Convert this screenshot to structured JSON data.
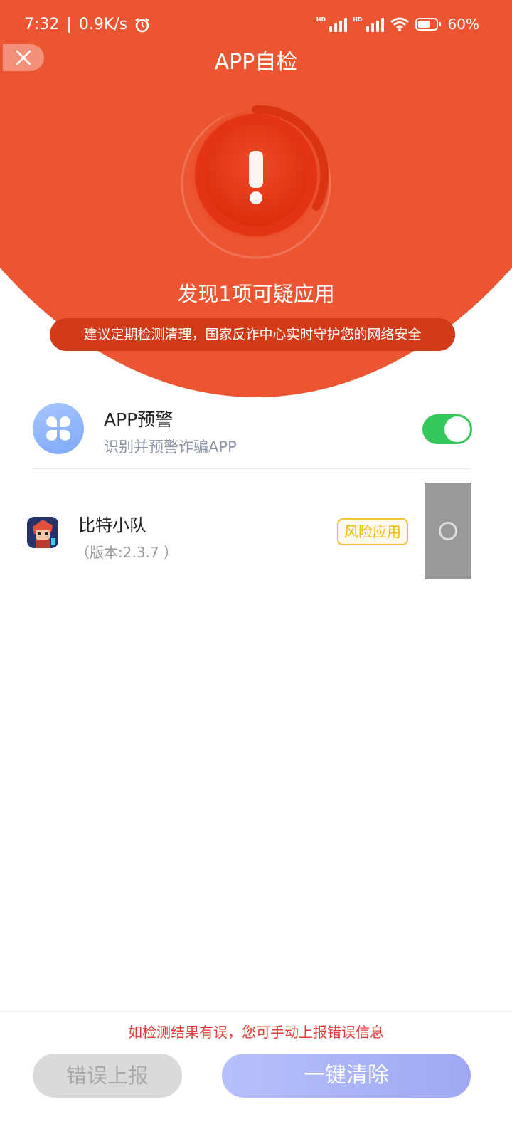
{
  "status_bar": {
    "time": "7:32",
    "separator": "|",
    "net_speed": "0.9K/s",
    "sim1_label": "HD",
    "sim2_label": "HD",
    "battery": "60%"
  },
  "header": {
    "title": "APP自检",
    "background_color": "#EC5532"
  },
  "scan_result": {
    "headline": "发现1项可疑应用",
    "advice": "建议定期检测清理，国家反诈中心实时守护您的网络安全"
  },
  "feature": {
    "name": "APP预警",
    "description": "识别并预警诈骗APP",
    "enabled": true,
    "toggle_color": "#34C759"
  },
  "apps": [
    {
      "name": "比特小队",
      "version": "（版本:2.3.7 ）",
      "badge": "风险应用",
      "selected": false
    }
  ],
  "footer": {
    "note": "如检测结果有误，您可手动上报错误信息",
    "report_button": "错误上报",
    "clean_button": "一键清除"
  }
}
